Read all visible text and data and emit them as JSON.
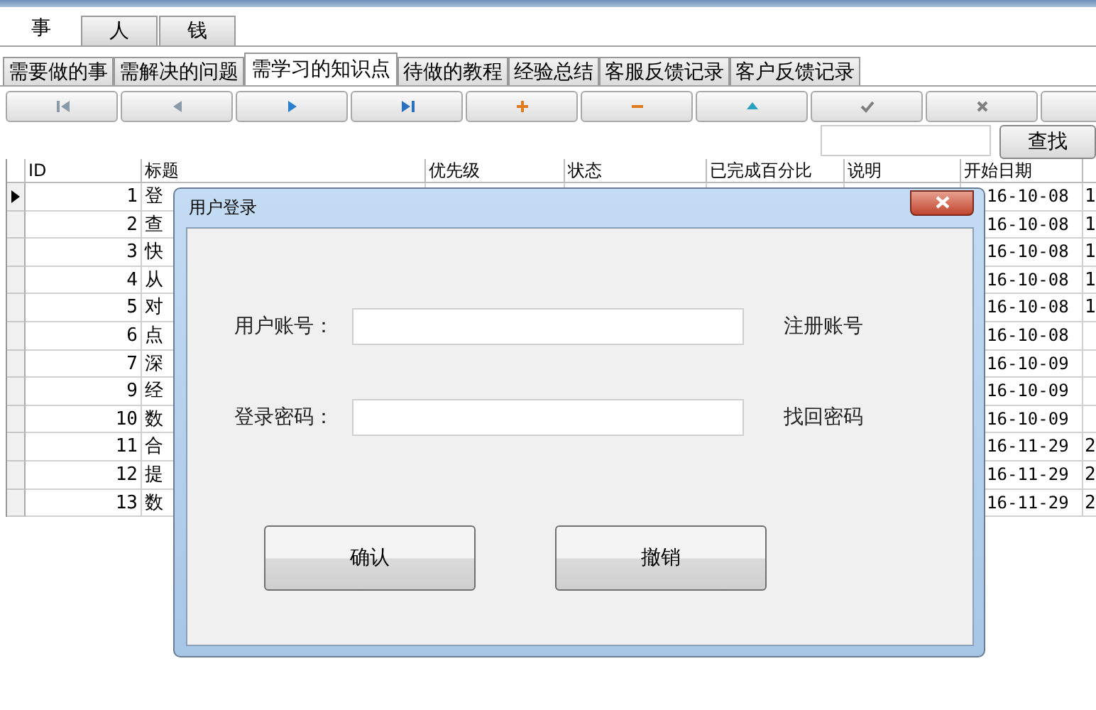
{
  "top_tabs": [
    {
      "label": "事",
      "selected": true
    },
    {
      "label": "人",
      "selected": false
    },
    {
      "label": "钱",
      "selected": false
    }
  ],
  "sub_tabs": [
    {
      "label": "需要做的事",
      "selected": false
    },
    {
      "label": "需解决的问题",
      "selected": false
    },
    {
      "label": "需学习的知识点",
      "selected": true
    },
    {
      "label": "待做的教程",
      "selected": false
    },
    {
      "label": "经验总结",
      "selected": false
    },
    {
      "label": "客服反馈记录",
      "selected": false
    },
    {
      "label": "客户反馈记录",
      "selected": false
    }
  ],
  "toolbar": [
    {
      "kind": "first"
    },
    {
      "kind": "prev"
    },
    {
      "kind": "next"
    },
    {
      "kind": "last"
    },
    {
      "kind": "add"
    },
    {
      "kind": "remove"
    },
    {
      "kind": "up"
    },
    {
      "kind": "check"
    },
    {
      "kind": "cancel"
    },
    {
      "kind": "blank"
    }
  ],
  "search": {
    "button": "查找"
  },
  "table": {
    "columns": [
      "ID",
      "标题",
      "优先级",
      "状态",
      "已完成百分比",
      "说明",
      "开始日期"
    ],
    "rows": [
      {
        "id": "1",
        "title": "登",
        "start": "16-10-08",
        "column_8": "1",
        "selected": true
      },
      {
        "id": "2",
        "title": "查",
        "start": "16-10-08",
        "column_8": "1",
        "selected": false
      },
      {
        "id": "3",
        "title": "快",
        "start": "16-10-08",
        "column_8": "1",
        "selected": false
      },
      {
        "id": "4",
        "title": "从",
        "start": "16-10-08",
        "column_8": "1",
        "selected": false
      },
      {
        "id": "5",
        "title": "对",
        "start": "16-10-08",
        "column_8": "1",
        "selected": false
      },
      {
        "id": "6",
        "title": "点",
        "start": "16-10-08",
        "selected": false
      },
      {
        "id": "7",
        "title": "深",
        "start": "16-10-09",
        "selected": false
      },
      {
        "id": "9",
        "title": "经",
        "start": "16-10-09",
        "selected": false
      },
      {
        "id": "10",
        "title": "数",
        "start": "16-10-09",
        "selected": false
      },
      {
        "id": "11",
        "title": "合",
        "start": "16-11-29",
        "column_8": "2",
        "selected": false
      },
      {
        "id": "12",
        "title": "提",
        "start": "16-11-29",
        "column_8": "2",
        "selected": false
      },
      {
        "id": "13",
        "title": "数",
        "start": "16-11-29",
        "column_8": "2",
        "selected": false
      }
    ]
  },
  "dialog": {
    "title": "用户登录",
    "fields": [
      {
        "label": "用户账号：",
        "link": "注册账号"
      },
      {
        "label": "登录密码：",
        "link": "找回密码"
      }
    ],
    "buttons": [
      "确认",
      "撤销"
    ]
  }
}
